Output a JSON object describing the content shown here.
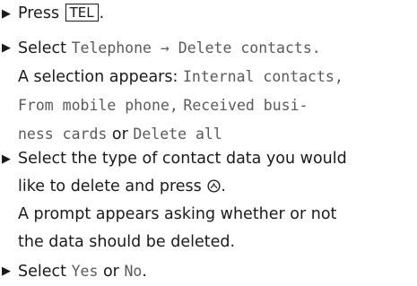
{
  "bullet_glyph": "▶",
  "steps": [
    {
      "before": "Press",
      "key": "TEL",
      "after": "."
    },
    {
      "before": "Select",
      "menu_path": "Telephone → Delete contacts.",
      "line2_text": "A selection appears:",
      "option_1": "Internal contacts,",
      "option_2": "From mobile phone,",
      "option_3a": "Received busi-",
      "option_3b": "ness cards",
      "joiner": "or",
      "option_4": "Delete all"
    },
    {
      "line1": "Select the type of contact data you would",
      "line2_text": "like to delete and press",
      "control_icon": "rotary-controller-icon",
      "after": ".",
      "line3": "A prompt appears asking whether or not",
      "line4": "the data should be deleted."
    },
    {
      "before": "Select",
      "yes": "Yes",
      "joiner": "or",
      "no": "No",
      "after": "."
    }
  ]
}
